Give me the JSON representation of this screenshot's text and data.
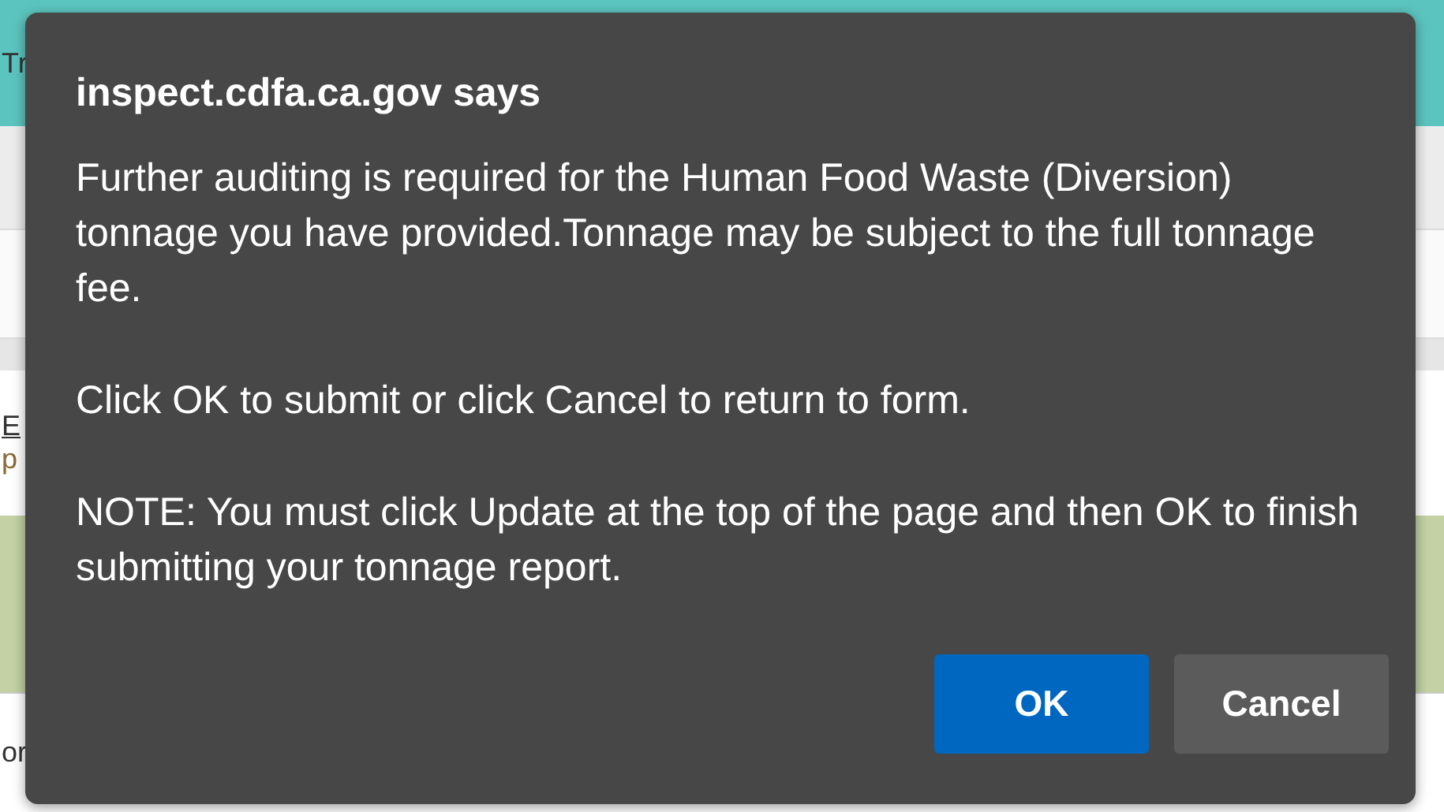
{
  "background": {
    "header_fragment": "Tr",
    "link_fragment": "E",
    "text_fragment": "p",
    "footer_fragment": "or"
  },
  "dialog": {
    "title": "inspect.cdfa.ca.gov says",
    "paragraphs": [
      "Further auditing is required for the Human Food Waste (Diversion) tonnage you have provided.Tonnage may be subject to the full tonnage fee.",
      "Click OK to submit or click Cancel to return to form.",
      "NOTE: You must click Update at the top of the page and then OK to finish submitting your tonnage report."
    ],
    "buttons": [
      {
        "label": "OK",
        "kind": "primary"
      },
      {
        "label": "Cancel",
        "kind": "secondary"
      }
    ]
  }
}
